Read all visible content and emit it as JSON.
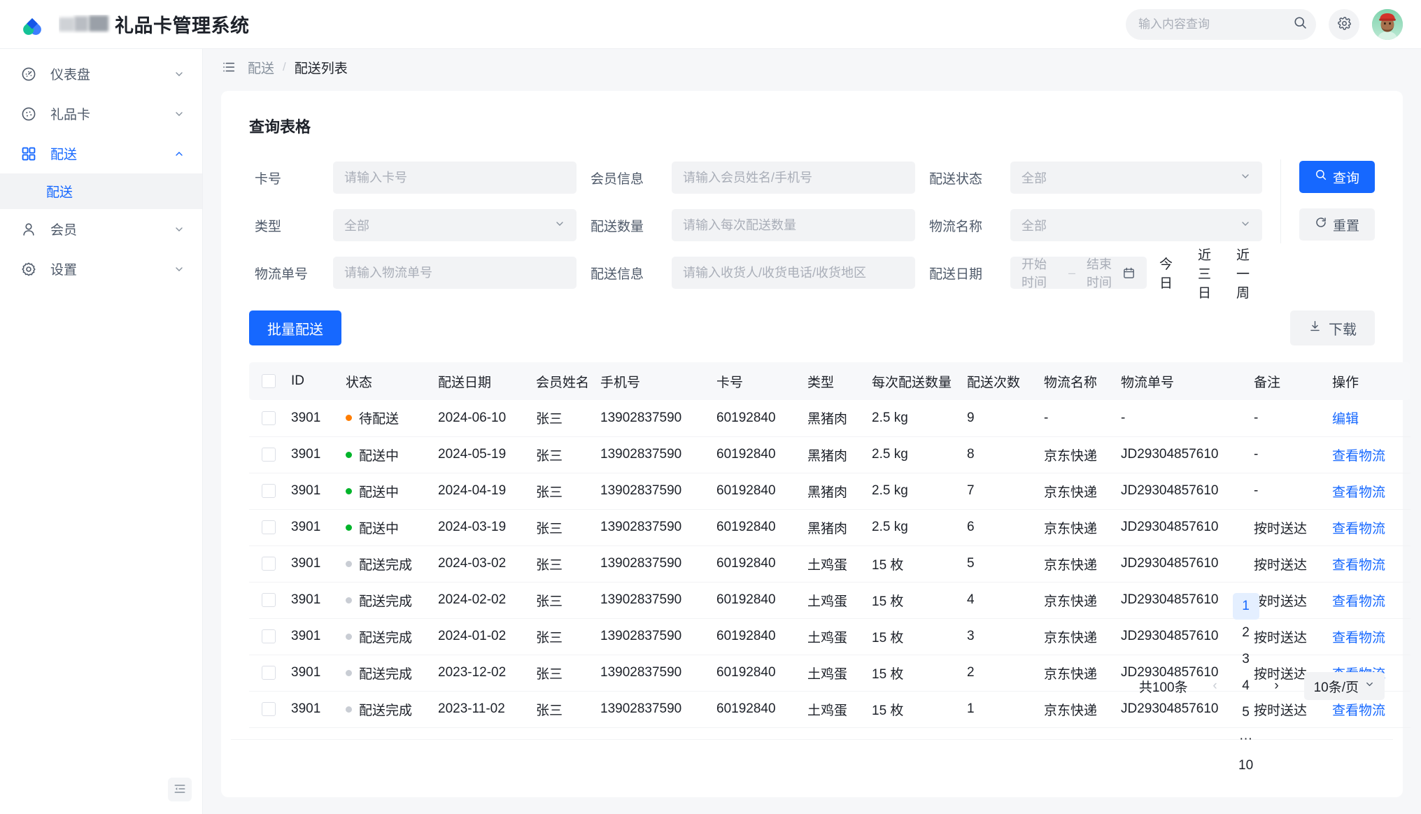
{
  "header": {
    "title_suffix": "礼品卡管理系统",
    "title_redacted": true,
    "search": {
      "value": "",
      "placeholder": "输入内容查询"
    },
    "settings_label": "设置",
    "avatar_label": "用户头像"
  },
  "sidebar": {
    "items": [
      {
        "label": "仪表盘",
        "icon": "dashboard-icon",
        "expandable": true,
        "active": false
      },
      {
        "label": "礼品卡",
        "icon": "giftcard-icon",
        "expandable": true,
        "active": false
      },
      {
        "label": "配送",
        "icon": "grid-icon",
        "expandable": true,
        "active": true
      },
      {
        "label": "会员",
        "icon": "user-icon",
        "expandable": true,
        "active": false
      },
      {
        "label": "设置",
        "icon": "gear-icon",
        "expandable": true,
        "active": false
      }
    ],
    "sub_items": [
      {
        "label": "配送",
        "active": true
      }
    ],
    "collapse_label": "折叠菜单"
  },
  "breadcrumb": {
    "menu_icon": "list-icon",
    "parent": "配送",
    "separator": "/",
    "current": "配送列表"
  },
  "query_panel": {
    "title": "查询表格",
    "fields": {
      "card_no": {
        "label": "卡号",
        "placeholder": "请输入卡号",
        "value": ""
      },
      "member_info": {
        "label": "会员信息",
        "placeholder": "请输入会员姓名/手机号",
        "value": ""
      },
      "ship_status": {
        "label": "配送状态",
        "value": "全部"
      },
      "type": {
        "label": "类型",
        "value": "全部"
      },
      "ship_qty": {
        "label": "配送数量",
        "placeholder": "请输入每次配送数量",
        "value": ""
      },
      "logistics_name": {
        "label": "物流名称",
        "value": "全部"
      },
      "tracking_no": {
        "label": "物流单号",
        "placeholder": "请输入物流单号",
        "value": ""
      },
      "ship_info": {
        "label": "配送信息",
        "placeholder": "请输入收货人/收货电话/收货地区",
        "value": ""
      },
      "ship_date": {
        "label": "配送日期",
        "start_placeholder": "开始时间",
        "end_placeholder": "结束时间",
        "dash": "–"
      }
    },
    "quick_ranges": [
      "今日",
      "近三日",
      "近一周"
    ],
    "search_button": "查询",
    "reset_button": "重置"
  },
  "toolbar": {
    "batch_ship": "批量配送",
    "download": "下载"
  },
  "table": {
    "columns": [
      "",
      "ID",
      "状态",
      "配送日期",
      "会员姓名",
      "手机号",
      "卡号",
      "类型",
      "每次配送数量",
      "配送次数",
      "物流名称",
      "物流单号",
      "备注",
      "操作"
    ],
    "rows": [
      {
        "id": "3901",
        "status": "待配送",
        "status_color": "#ff7d00",
        "date": "2024-06-10",
        "name": "张三",
        "phone": "13902837590",
        "card": "60192840",
        "type": "黑猪肉",
        "qty": "2.5 kg",
        "times": "9",
        "logistics": "-",
        "tracking": "-",
        "remark": "-",
        "action": "编辑"
      },
      {
        "id": "3901",
        "status": "配送中",
        "status_color": "#00b42a",
        "date": "2024-05-19",
        "name": "张三",
        "phone": "13902837590",
        "card": "60192840",
        "type": "黑猪肉",
        "qty": "2.5 kg",
        "times": "8",
        "logistics": "京东快递",
        "tracking": "JD29304857610",
        "remark": "-",
        "action": "查看物流"
      },
      {
        "id": "3901",
        "status": "配送中",
        "status_color": "#00b42a",
        "date": "2024-04-19",
        "name": "张三",
        "phone": "13902837590",
        "card": "60192840",
        "type": "黑猪肉",
        "qty": "2.5 kg",
        "times": "7",
        "logistics": "京东快递",
        "tracking": "JD29304857610",
        "remark": "-",
        "action": "查看物流"
      },
      {
        "id": "3901",
        "status": "配送中",
        "status_color": "#00b42a",
        "date": "2024-03-19",
        "name": "张三",
        "phone": "13902837590",
        "card": "60192840",
        "type": "黑猪肉",
        "qty": "2.5 kg",
        "times": "6",
        "logistics": "京东快递",
        "tracking": "JD29304857610",
        "remark": "按时送达",
        "action": "查看物流"
      },
      {
        "id": "3901",
        "status": "配送完成",
        "status_color": "#c9cdd4",
        "date": "2024-03-02",
        "name": "张三",
        "phone": "13902837590",
        "card": "60192840",
        "type": "土鸡蛋",
        "qty": "15 枚",
        "times": "5",
        "logistics": "京东快递",
        "tracking": "JD29304857610",
        "remark": "按时送达",
        "action": "查看物流"
      },
      {
        "id": "3901",
        "status": "配送完成",
        "status_color": "#c9cdd4",
        "date": "2024-02-02",
        "name": "张三",
        "phone": "13902837590",
        "card": "60192840",
        "type": "土鸡蛋",
        "qty": "15 枚",
        "times": "4",
        "logistics": "京东快递",
        "tracking": "JD29304857610",
        "remark": "按时送达",
        "action": "查看物流"
      },
      {
        "id": "3901",
        "status": "配送完成",
        "status_color": "#c9cdd4",
        "date": "2024-01-02",
        "name": "张三",
        "phone": "13902837590",
        "card": "60192840",
        "type": "土鸡蛋",
        "qty": "15 枚",
        "times": "3",
        "logistics": "京东快递",
        "tracking": "JD29304857610",
        "remark": "按时送达",
        "action": "查看物流"
      },
      {
        "id": "3901",
        "status": "配送完成",
        "status_color": "#c9cdd4",
        "date": "2023-12-02",
        "name": "张三",
        "phone": "13902837590",
        "card": "60192840",
        "type": "土鸡蛋",
        "qty": "15 枚",
        "times": "2",
        "logistics": "京东快递",
        "tracking": "JD29304857610",
        "remark": "按时送达",
        "action": "查看物流"
      },
      {
        "id": "3901",
        "status": "配送完成",
        "status_color": "#c9cdd4",
        "date": "2023-11-02",
        "name": "张三",
        "phone": "13902837590",
        "card": "60192840",
        "type": "土鸡蛋",
        "qty": "15 枚",
        "times": "1",
        "logistics": "京东快递",
        "tracking": "JD29304857610",
        "remark": "按时送达",
        "action": "查看物流"
      }
    ]
  },
  "pagination": {
    "total_text": "共100条",
    "prev": "‹",
    "pages": [
      "1",
      "2",
      "3",
      "4",
      "5",
      "···",
      "10"
    ],
    "current": "1",
    "next": "›",
    "page_size": "10条/页"
  },
  "colors": {
    "primary": "#1668ff",
    "status_pending": "#ff7d00",
    "status_shipping": "#00b42a",
    "status_done": "#c9cdd4",
    "page_bg": "#f6f7f9",
    "field_bg": "#f2f3f5"
  }
}
